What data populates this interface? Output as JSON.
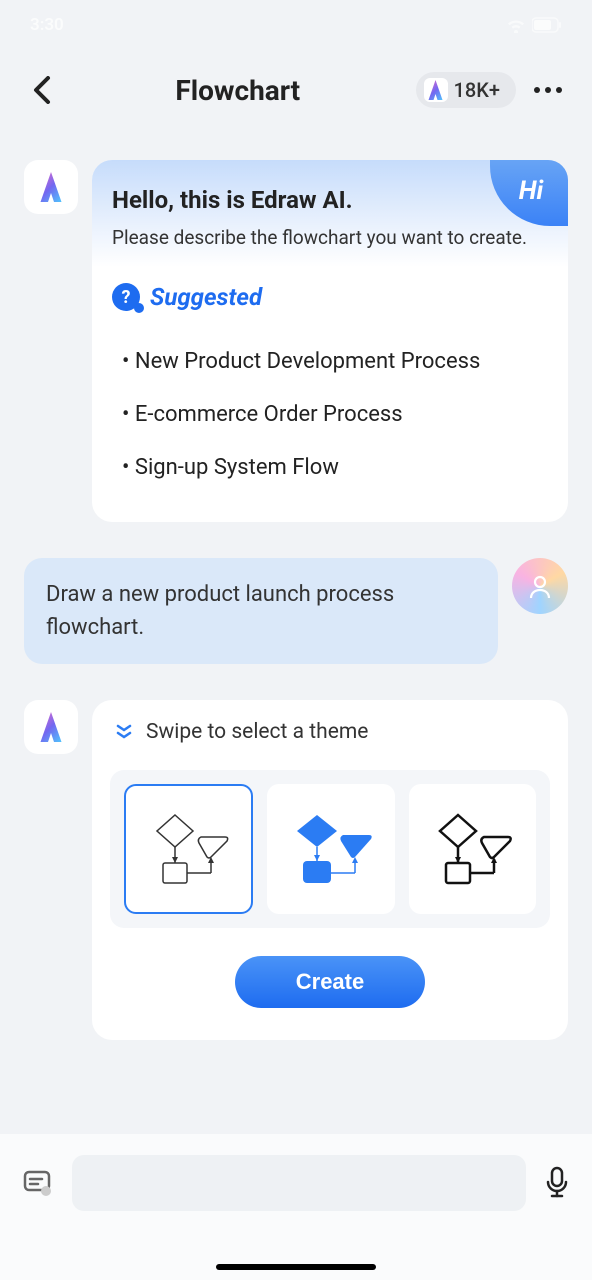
{
  "status": {
    "time": "3:30",
    "battery": "72"
  },
  "header": {
    "title": "Flowchart",
    "usage_count": "18K+"
  },
  "ai_intro": {
    "hi": "Hi",
    "greeting": "Hello, this is Edraw AI.",
    "prompt": "Please describe the flowchart you want to create.",
    "suggested_label": "Suggested",
    "suggestions": [
      "New Product Development Process",
      "E-commerce Order Process",
      "Sign-up System Flow"
    ]
  },
  "user_msg": "Draw a new product launch process flowchart.",
  "theme": {
    "swipe_label": "Swipe to select a theme",
    "create_label": "Create",
    "options": [
      "outline-light",
      "filled-blue",
      "outline-bold"
    ],
    "selected_index": 0
  }
}
